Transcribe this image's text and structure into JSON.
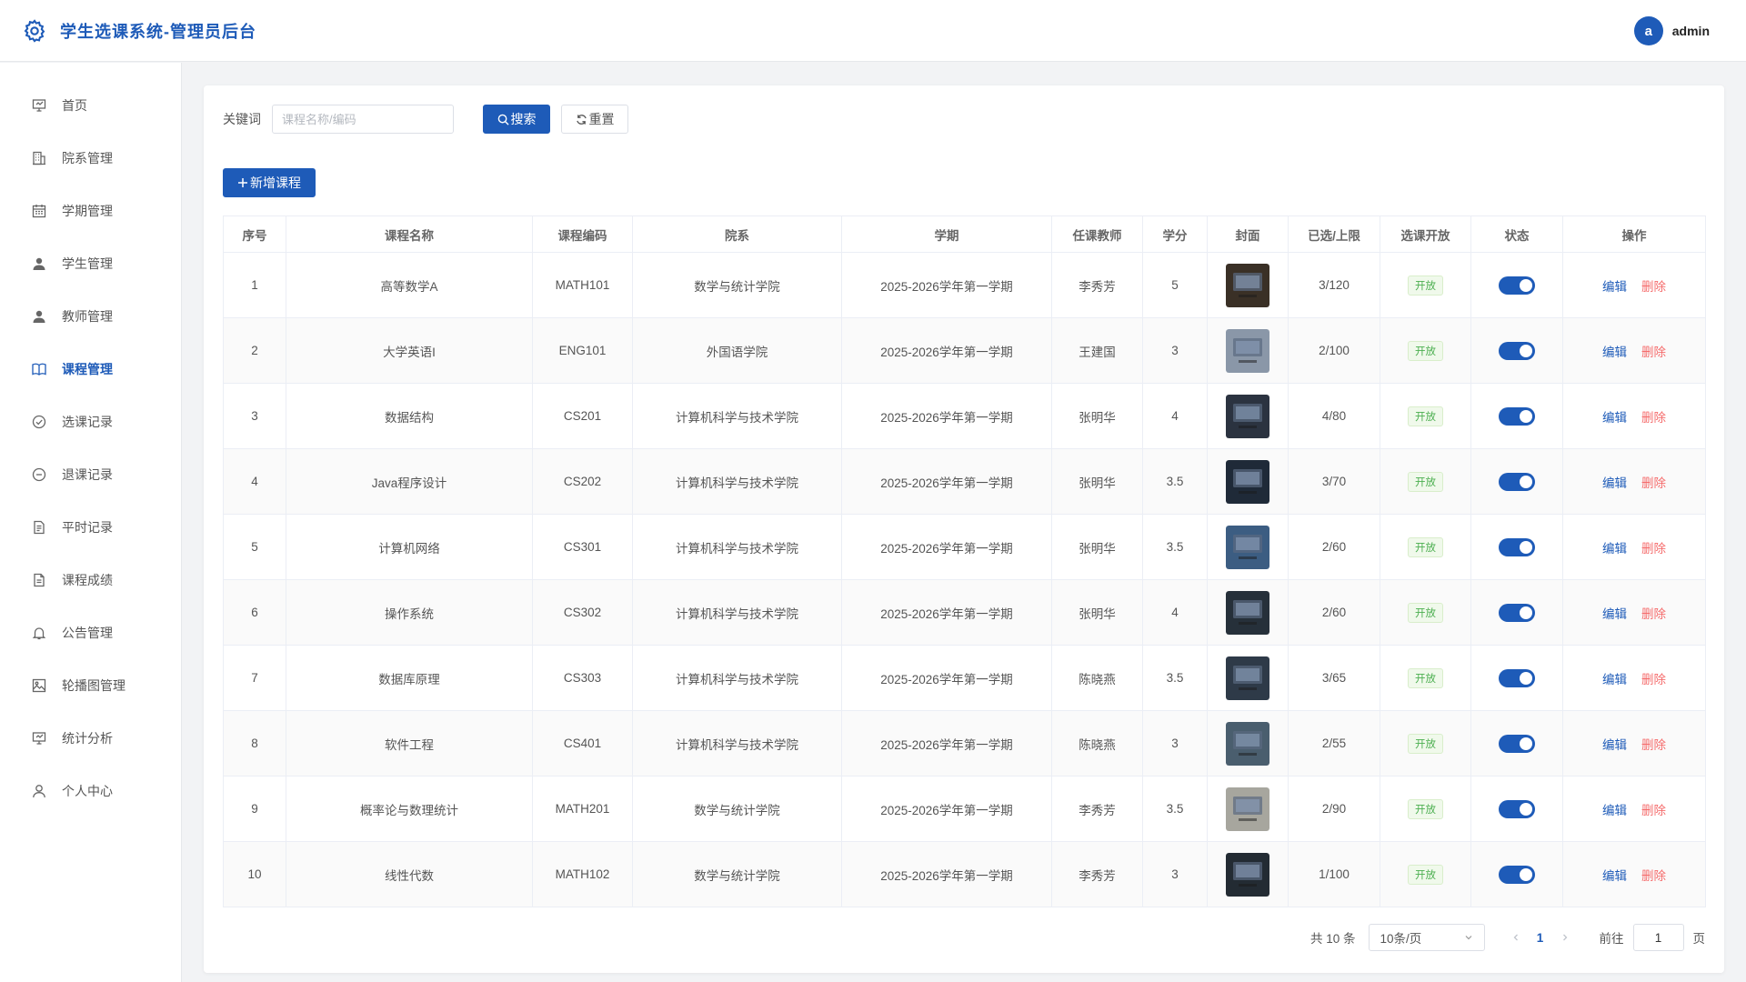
{
  "header": {
    "title": "学生选课系统-管理员后台",
    "avatar_letter": "a",
    "username": "admin"
  },
  "sidebar": {
    "items": [
      {
        "label": "首页",
        "icon": "presentation-icon"
      },
      {
        "label": "院系管理",
        "icon": "building-icon"
      },
      {
        "label": "学期管理",
        "icon": "calendar-icon"
      },
      {
        "label": "学生管理",
        "icon": "user-filled-icon"
      },
      {
        "label": "教师管理",
        "icon": "user-filled-icon"
      },
      {
        "label": "课程管理",
        "icon": "book-icon",
        "active": true
      },
      {
        "label": "选课记录",
        "icon": "check-circle-icon"
      },
      {
        "label": "退课记录",
        "icon": "minus-circle-icon"
      },
      {
        "label": "平时记录",
        "icon": "document-icon"
      },
      {
        "label": "课程成绩",
        "icon": "document-icon"
      },
      {
        "label": "公告管理",
        "icon": "bell-icon"
      },
      {
        "label": "轮播图管理",
        "icon": "picture-icon"
      },
      {
        "label": "统计分析",
        "icon": "presentation-icon"
      },
      {
        "label": "个人中心",
        "icon": "user-outline-icon"
      }
    ]
  },
  "search": {
    "label": "关键词",
    "placeholder": "课程名称/编码",
    "value": "",
    "search_label": "搜索",
    "reset_label": "重置"
  },
  "toolbar": {
    "add_label": "新增课程"
  },
  "table": {
    "columns": [
      "序号",
      "课程名称",
      "课程编码",
      "院系",
      "学期",
      "任课教师",
      "学分",
      "封面",
      "已选/上限",
      "选课开放",
      "状态",
      "操作"
    ],
    "edit_label": "编辑",
    "delete_label": "删除",
    "rows": [
      {
        "no": "1",
        "name": "高等数学A",
        "code": "MATH101",
        "dept": "数学与统计学院",
        "term": "2025-2026学年第一学期",
        "teacher": "李秀芳",
        "credit": "5",
        "enrolled": "3/120",
        "open": "开放",
        "status_on": true,
        "cover_color": "#3a3026"
      },
      {
        "no": "2",
        "name": "大学英语I",
        "code": "ENG101",
        "dept": "外国语学院",
        "term": "2025-2026学年第一学期",
        "teacher": "王建国",
        "credit": "3",
        "enrolled": "2/100",
        "open": "开放",
        "status_on": true,
        "cover_color": "#8a97a8"
      },
      {
        "no": "3",
        "name": "数据结构",
        "code": "CS201",
        "dept": "计算机科学与技术学院",
        "term": "2025-2026学年第一学期",
        "teacher": "张明华",
        "credit": "4",
        "enrolled": "4/80",
        "open": "开放",
        "status_on": true,
        "cover_color": "#2b3340"
      },
      {
        "no": "4",
        "name": "Java程序设计",
        "code": "CS202",
        "dept": "计算机科学与技术学院",
        "term": "2025-2026学年第一学期",
        "teacher": "张明华",
        "credit": "3.5",
        "enrolled": "3/70",
        "open": "开放",
        "status_on": true,
        "cover_color": "#1f2a38"
      },
      {
        "no": "5",
        "name": "计算机网络",
        "code": "CS301",
        "dept": "计算机科学与技术学院",
        "term": "2025-2026学年第一学期",
        "teacher": "张明华",
        "credit": "3.5",
        "enrolled": "2/60",
        "open": "开放",
        "status_on": true,
        "cover_color": "#3c5d82"
      },
      {
        "no": "6",
        "name": "操作系统",
        "code": "CS302",
        "dept": "计算机科学与技术学院",
        "term": "2025-2026学年第一学期",
        "teacher": "张明华",
        "credit": "4",
        "enrolled": "2/60",
        "open": "开放",
        "status_on": true,
        "cover_color": "#26303a"
      },
      {
        "no": "7",
        "name": "数据库原理",
        "code": "CS303",
        "dept": "计算机科学与技术学院",
        "term": "2025-2026学年第一学期",
        "teacher": "陈晓燕",
        "credit": "3.5",
        "enrolled": "3/65",
        "open": "开放",
        "status_on": true,
        "cover_color": "#2e3a48"
      },
      {
        "no": "8",
        "name": "软件工程",
        "code": "CS401",
        "dept": "计算机科学与技术学院",
        "term": "2025-2026学年第一学期",
        "teacher": "陈晓燕",
        "credit": "3",
        "enrolled": "2/55",
        "open": "开放",
        "status_on": true,
        "cover_color": "#4a5e6e"
      },
      {
        "no": "9",
        "name": "概率论与数理统计",
        "code": "MATH201",
        "dept": "数学与统计学院",
        "term": "2025-2026学年第一学期",
        "teacher": "李秀芳",
        "credit": "3.5",
        "enrolled": "2/90",
        "open": "开放",
        "status_on": true,
        "cover_color": "#a7a69e"
      },
      {
        "no": "10",
        "name": "线性代数",
        "code": "MATH102",
        "dept": "数学与统计学院",
        "term": "2025-2026学年第一学期",
        "teacher": "李秀芳",
        "credit": "3",
        "enrolled": "1/100",
        "open": "开放",
        "status_on": true,
        "cover_color": "#232b33"
      }
    ]
  },
  "pagination": {
    "total_text": "共 10 条",
    "page_size": "10条/页",
    "current_page": "1",
    "goto_label": "前往",
    "goto_value": "1",
    "page_suffix": "页"
  },
  "colors": {
    "primary": "#1e5bb8",
    "danger": "#f56c6c",
    "success": "#4caf50"
  }
}
